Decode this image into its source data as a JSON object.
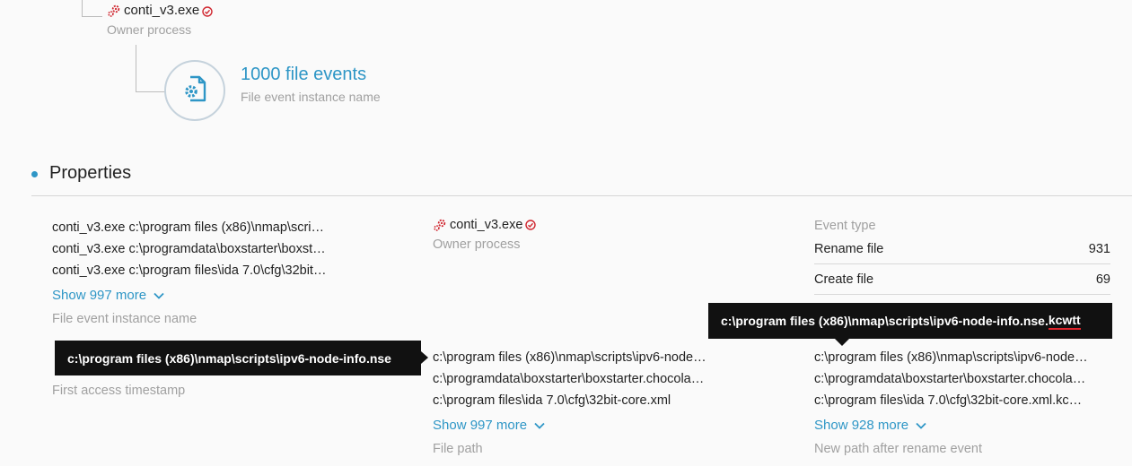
{
  "tree": {
    "owner_name": "conti_v3.exe",
    "owner_label": "Owner process",
    "events_title": "1000 file events",
    "events_label": "File event instance name",
    "icon": "file-gear-icon"
  },
  "properties": {
    "title": "Properties",
    "instances": {
      "rows": [
        "conti_v3.exe c:\\program files (x86)\\nmap\\scri…",
        "conti_v3.exe c:\\programdata\\boxstarter\\boxst…",
        "conti_v3.exe c:\\program files\\ida 7.0\\cfg\\32bit…"
      ],
      "show_more": "Show 997 more",
      "label": "File event instance name"
    },
    "owner": {
      "name": "conti_v3.exe",
      "label": "Owner process"
    },
    "event_type": {
      "label": "Event type",
      "rows": [
        {
          "name": "Rename file",
          "count": "931"
        },
        {
          "name": "Create file",
          "count": "69"
        }
      ]
    },
    "first_access": {
      "label": "First access timestamp"
    },
    "file_path": {
      "rows": [
        "c:\\program files (x86)\\nmap\\scripts\\ipv6-node…",
        "c:\\programdata\\boxstarter\\boxstarter.chocola…",
        "c:\\program files\\ida 7.0\\cfg\\32bit-core.xml"
      ],
      "show_more": "Show 997 more",
      "label": "File path"
    },
    "new_path": {
      "rows": [
        "c:\\program files (x86)\\nmap\\scripts\\ipv6-node…",
        "c:\\programdata\\boxstarter\\boxstarter.chocola…",
        "c:\\program files\\ida 7.0\\cfg\\32bit-core.xml.kc…"
      ],
      "show_more": "Show 928 more",
      "label": "New path after rename event"
    }
  },
  "tooltips": {
    "left": "c:\\program files (x86)\\nmap\\scripts\\ipv6-node-info.nse",
    "right_prefix": "c:\\program files (x86)\\nmap\\scripts\\ipv6-node-info.nse.",
    "right_ext": "kcwtt"
  },
  "colors": {
    "accent": "#2e96c6",
    "malicious": "#d0262f",
    "tooltip_bg": "#111111"
  }
}
